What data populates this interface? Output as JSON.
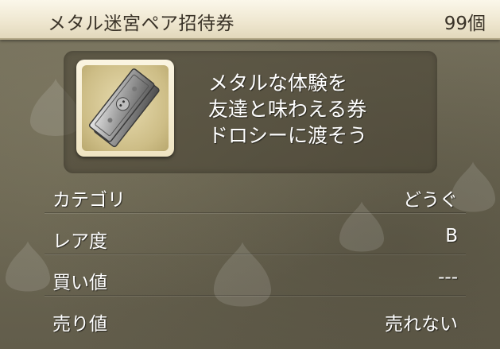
{
  "item": {
    "name": "メタル迷宮ペア招待券",
    "count": "99個",
    "icon": "metal-ticket-icon",
    "description": [
      "メタルな体験を",
      "友達と味わえる券",
      "ドロシーに渡そう"
    ]
  },
  "details": [
    {
      "label": "カテゴリ",
      "value": "どうぐ"
    },
    {
      "label": "レア度",
      "value": "B"
    },
    {
      "label": "買い値",
      "value": "---"
    },
    {
      "label": "売り値",
      "value": "売れない"
    }
  ],
  "colors": {
    "header_bg": "#f3ecd6",
    "panel_bg": "#6c6753",
    "text": "#ffffff"
  }
}
